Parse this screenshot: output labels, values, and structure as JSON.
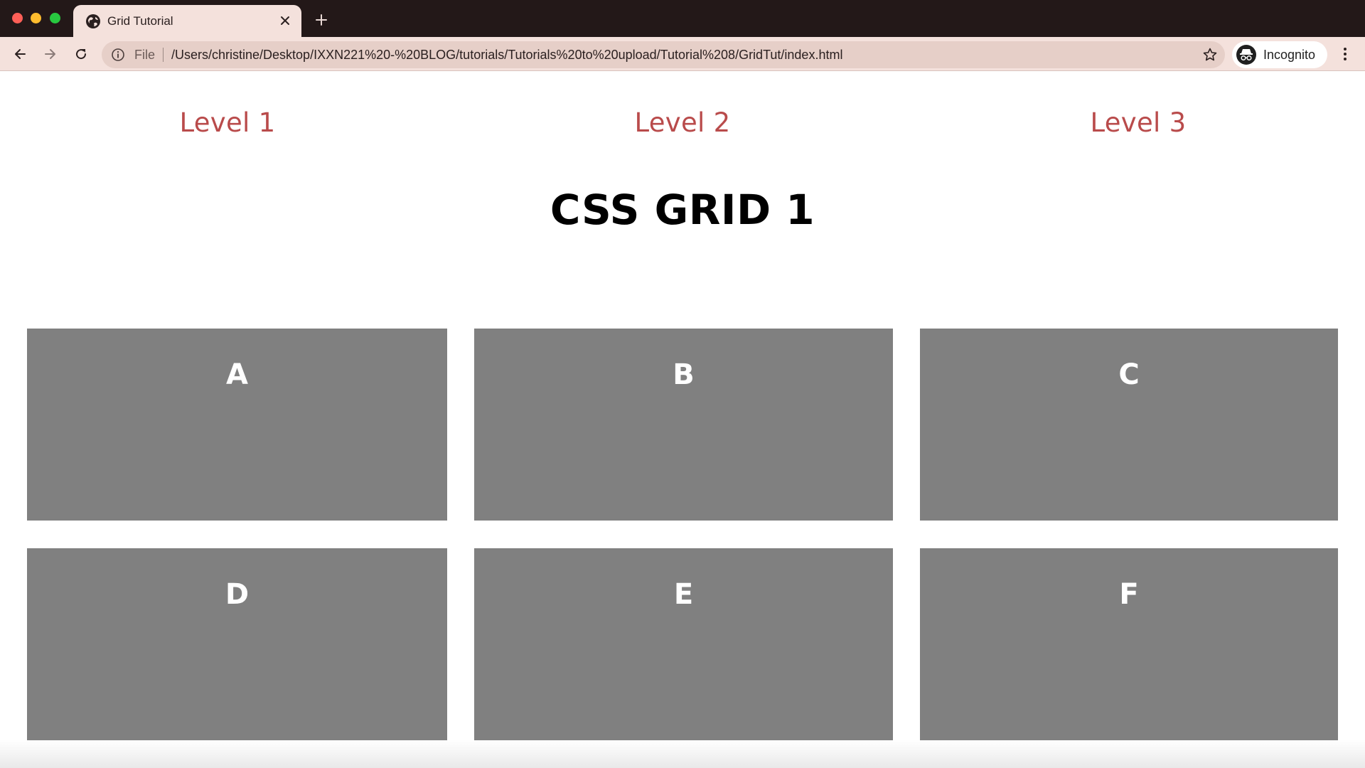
{
  "browser": {
    "tab_title": "Grid Tutorial",
    "address": {
      "scheme_label": "File",
      "url": "/Users/christine/Desktop/IXXN221%20-%20BLOG/tutorials/Tutorials%20to%20upload/Tutorial%208/GridTut/index.html"
    },
    "profile_label": "Incognito",
    "icons": {
      "tab": "globe-icon",
      "close": "close-icon",
      "new_tab": "plus-icon",
      "back": "back-arrow-icon",
      "forward": "forward-arrow-icon",
      "reload": "reload-icon",
      "site_info": "info-icon",
      "bookmark": "star-icon",
      "profile": "incognito-icon",
      "menu": "more-vert-icon"
    }
  },
  "page": {
    "nav": [
      {
        "label": "Level 1"
      },
      {
        "label": "Level 2"
      },
      {
        "label": "Level 3"
      }
    ],
    "heading": "CSS GRID 1",
    "grid_items": [
      {
        "label": "A"
      },
      {
        "label": "B"
      },
      {
        "label": "C"
      },
      {
        "label": "D"
      },
      {
        "label": "E"
      },
      {
        "label": "F"
      }
    ]
  },
  "colors": {
    "chrome_dark": "#231818",
    "chrome_light": "#f4e1dc",
    "nav_link": "#b94b4b",
    "grid_cell": "#808080"
  }
}
